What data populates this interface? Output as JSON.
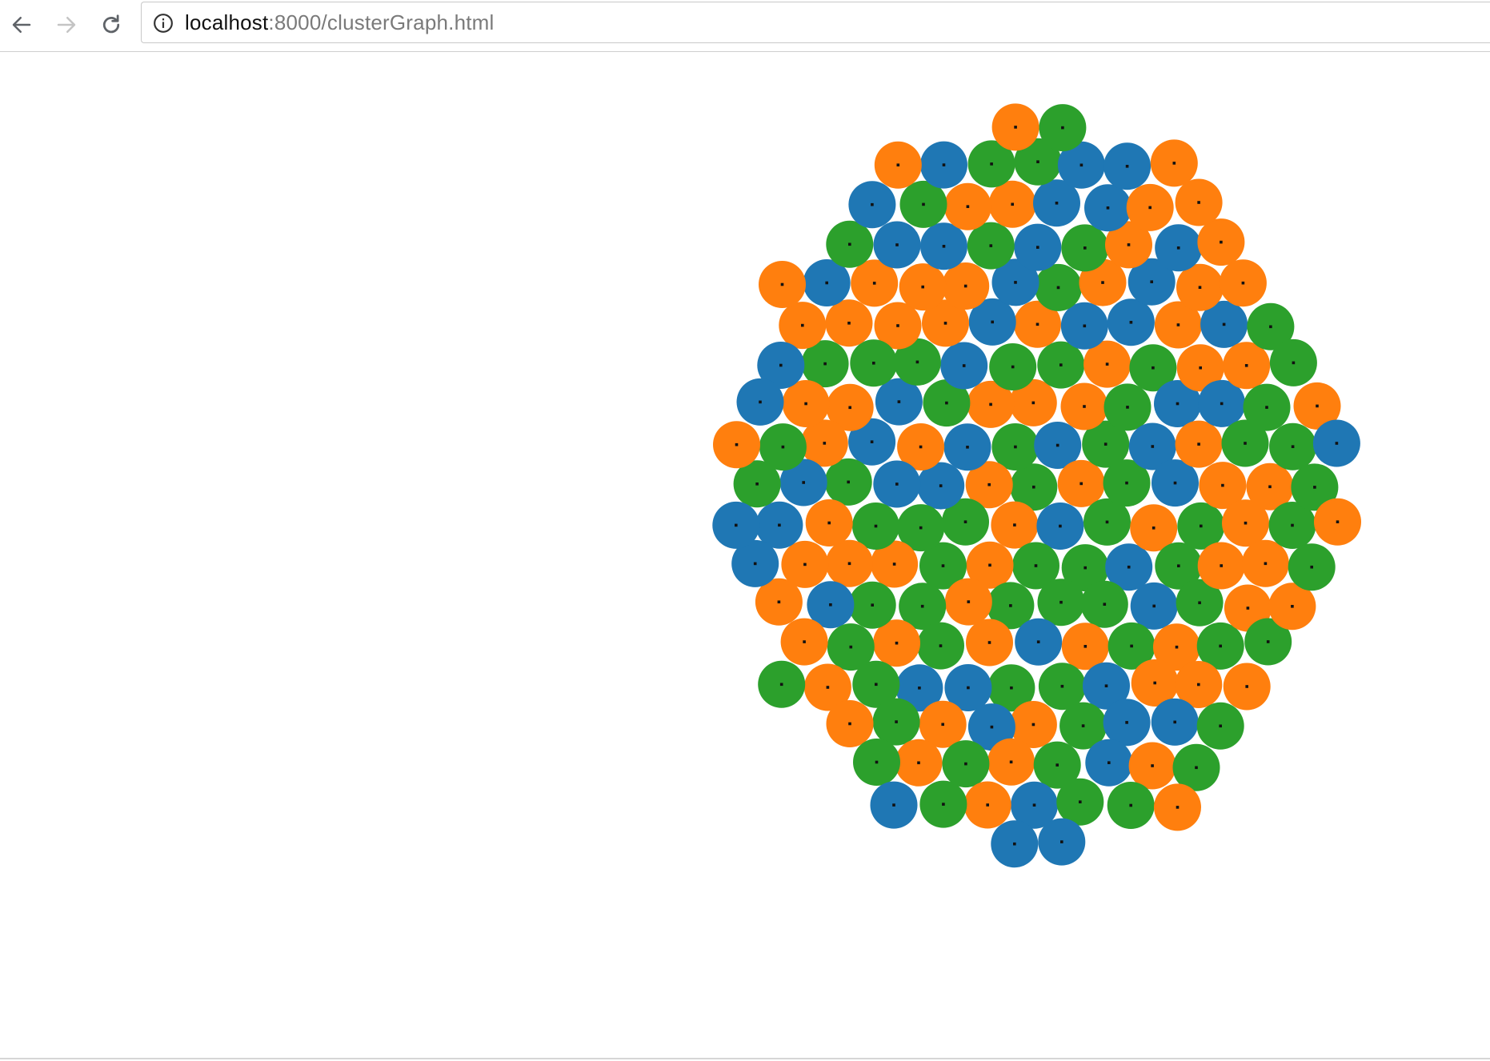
{
  "browser": {
    "url_host": "localhost",
    "url_rest": ":8000/clusterGraph.html",
    "icons": {
      "back": "arrow-left-icon",
      "forward": "arrow-right-icon",
      "reload": "reload-icon",
      "info": "info-icon"
    },
    "forward_enabled": false
  },
  "colors": {
    "blue": "#1f77b4",
    "orange": "#ff7f0e",
    "green": "#2ca02c",
    "node_dot": "#111111"
  },
  "graph": {
    "node_count": 187,
    "clusters": [
      "blue",
      "orange",
      "green"
    ]
  }
}
